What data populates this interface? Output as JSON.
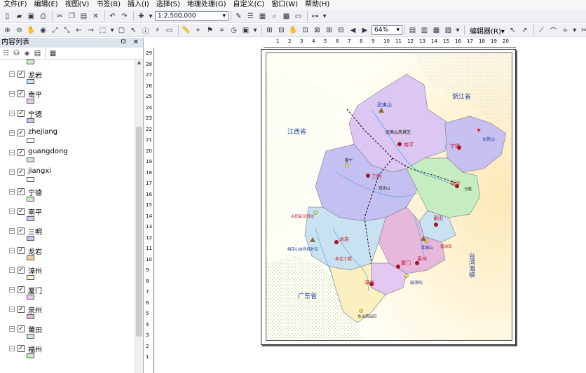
{
  "menu": [
    "文件(F)",
    "编辑(E)",
    "视图(V)",
    "书签(B)",
    "插入(I)",
    "选择(S)",
    "地理处理(G)",
    "自定义(C)",
    "窗口(W)",
    "帮助(H)"
  ],
  "toolbar": {
    "scale": "1:2,500,000",
    "zoom": "64%",
    "editor": "编辑器(R)▾"
  },
  "toc": {
    "title": "内容列表",
    "pin_buttons": "ㅁ ✕",
    "layers": [
      {
        "name": "龙岩",
        "checked": "✓",
        "color": "#c9e2f0"
      },
      {
        "name": "南平",
        "checked": "✓",
        "color": "#e2c8f0"
      },
      {
        "name": "宁德",
        "checked": "✓",
        "color": "#c9c2f2"
      },
      {
        "name": "zhejiang",
        "checked": "✓",
        "color": "#ffffff"
      },
      {
        "name": "guangdong",
        "checked": "✓",
        "color": "#c9e2f0"
      },
      {
        "name": "jiangxi",
        "checked": "✓",
        "color": "#ffffff"
      },
      {
        "name": "宁德",
        "checked": "✓",
        "color": "#c8ecc4"
      },
      {
        "name": "南平",
        "checked": "✓",
        "color": "#d9c7f0"
      },
      {
        "name": "三明",
        "checked": "✓",
        "color": "#c9c2f2"
      },
      {
        "name": "龙岩",
        "checked": "✓",
        "color": "#f2cfa8"
      },
      {
        "name": "漳州",
        "checked": "✓",
        "color": "#fbf2c4"
      },
      {
        "name": "厦门",
        "checked": "✓",
        "color": "#e8c8f0"
      },
      {
        "name": "泉州",
        "checked": "✓",
        "color": "#e8b8d8"
      },
      {
        "name": "莆田",
        "checked": "✓",
        "color": "#c9e2f0"
      },
      {
        "name": "福州",
        "checked": "✓",
        "color": "#c8ecc4"
      }
    ]
  },
  "ruler": {
    "h_ticks": [
      "1",
      "2",
      "3",
      "4",
      "5",
      "6",
      "7",
      "8",
      "9",
      "10",
      "11",
      "12",
      "13",
      "14",
      "15",
      "16",
      "17",
      "18",
      "19",
      "20"
    ],
    "v_ticks": [
      "29",
      "28",
      "27",
      "26",
      "25",
      "24",
      "23",
      "22",
      "21",
      "20",
      "19",
      "18",
      "17",
      "16",
      "15",
      "14",
      "13",
      "12",
      "11",
      "10",
      "9",
      "8",
      "7",
      "6",
      "5",
      "4",
      "3",
      "2",
      "1"
    ]
  },
  "map": {
    "labels": {
      "jiangxi": "江西省",
      "zhejiang": "浙江省",
      "guangdong": "广东省",
      "strait": "台湾海峡",
      "wuyishan": "武夷山",
      "nanping": "南平",
      "sanming": "三明",
      "ningde": "宁德",
      "fuzhou": "福州",
      "putian": "莆田",
      "quanzhou": "泉州",
      "xiamen": "厦门",
      "zhangzhou": "漳州",
      "longyan": "龙岩",
      "taimu": "太姥山",
      "yongding": "永定土楼",
      "reserve1": "武夷山风景区",
      "reserve2": "梅花山自然保护区",
      "reserve3": "古田会议旧址",
      "gulangyu": "鼓浪屿",
      "dongshan": "东山风动石",
      "qingyuan": "清源山",
      "taining": "泰宁",
      "meizhou": "湄洲岛",
      "mawei": "马尾",
      "guanzhi": "冠豸山"
    }
  }
}
